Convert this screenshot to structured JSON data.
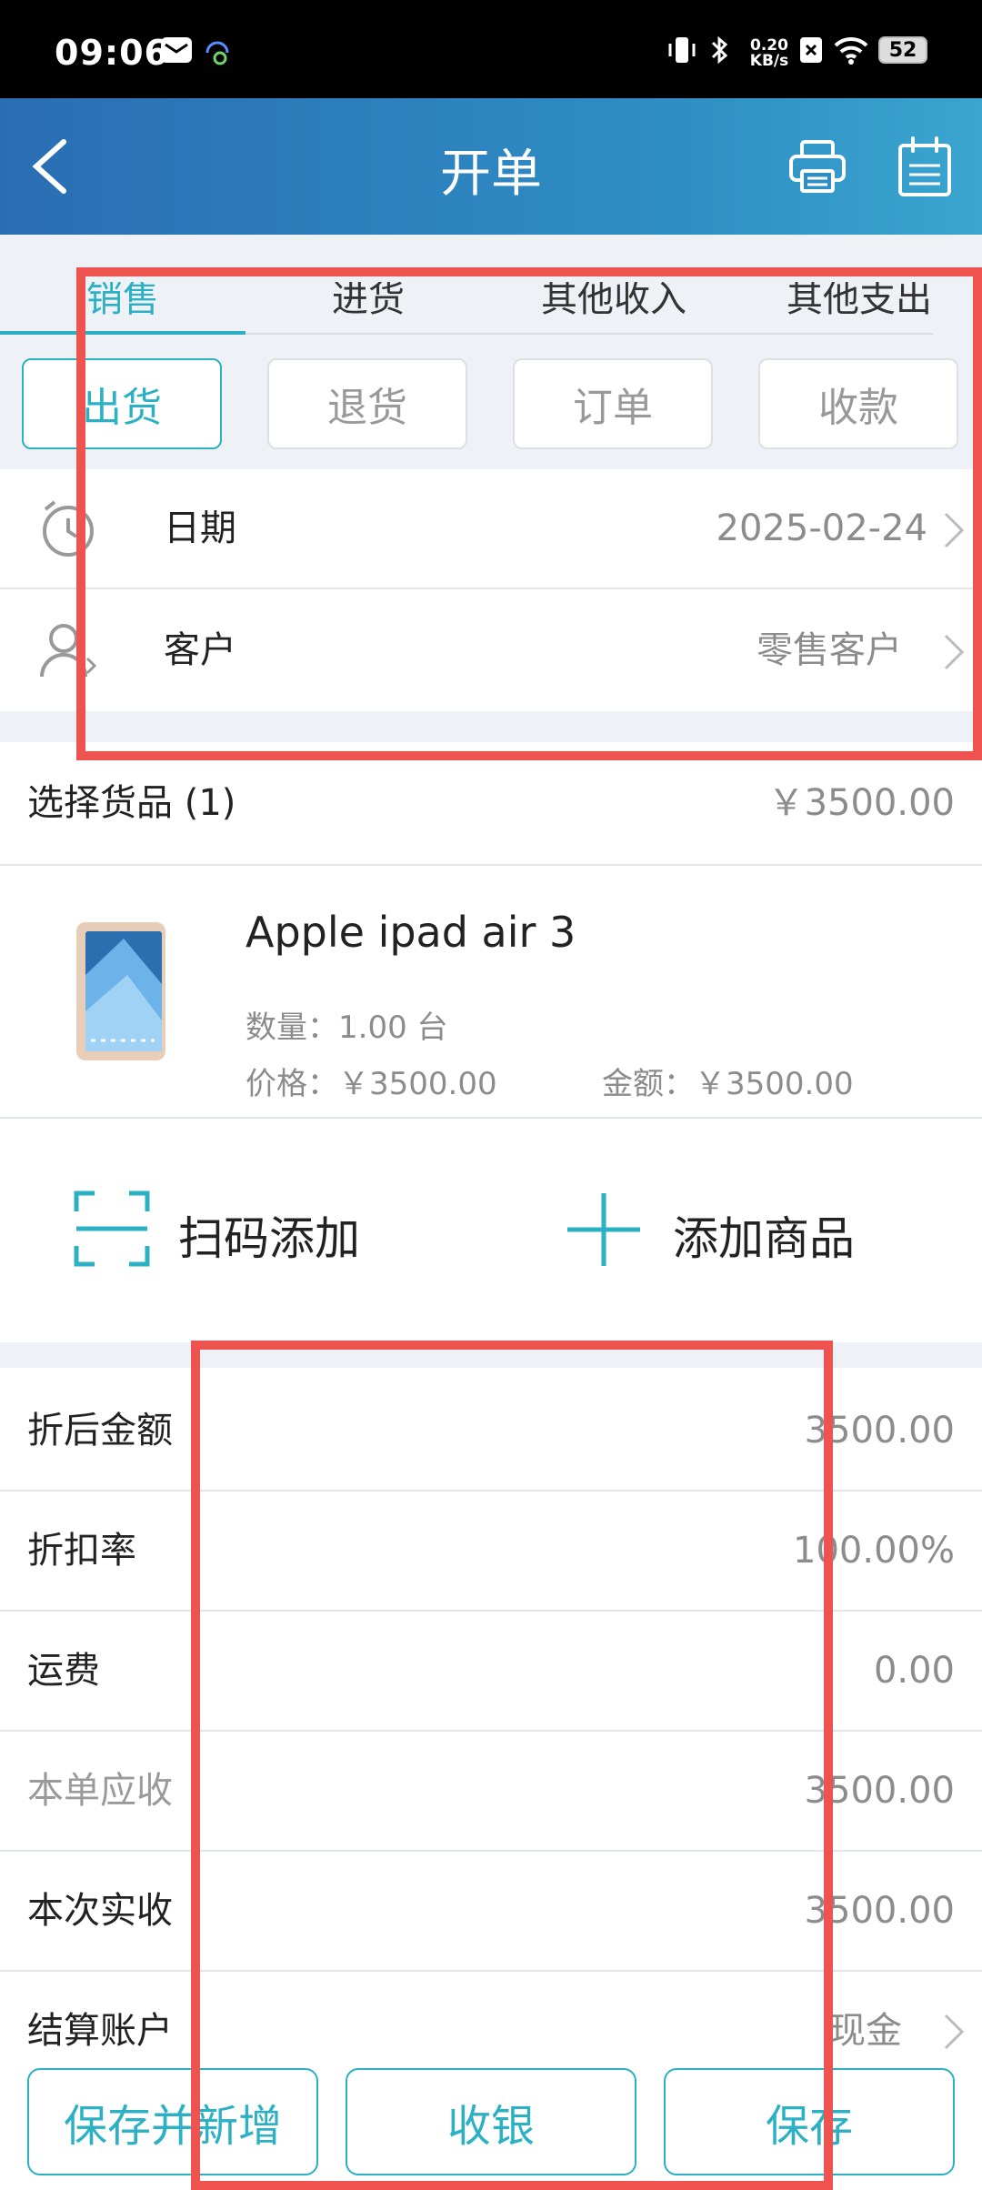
{
  "status_bar": {
    "time": "09:06",
    "speed_value": "0.20",
    "speed_unit": "KB/s",
    "battery": "52"
  },
  "app_bar": {
    "title": "开单"
  },
  "tabs": [
    {
      "label": "销售",
      "active": true
    },
    {
      "label": "进货",
      "active": false
    },
    {
      "label": "其他收入",
      "active": false
    },
    {
      "label": "其他支出",
      "active": false
    }
  ],
  "sub_tabs": [
    {
      "label": "出货",
      "active": true
    },
    {
      "label": "退货",
      "active": false
    },
    {
      "label": "订单",
      "active": false
    },
    {
      "label": "收款",
      "active": false
    }
  ],
  "info": {
    "date_label": "日期",
    "date_value": "2025-02-24",
    "customer_label": "客户",
    "customer_value": "零售客户"
  },
  "goods": {
    "header_label": "选择货品 (1)",
    "header_total": "￥3500.00",
    "product_name": "Apple ipad air 3",
    "quantity": "数量：1.00 台",
    "price": "价格：￥3500.00",
    "amount": "金额：￥3500.00"
  },
  "actions": {
    "scan_add": "扫码添加",
    "add_product": "添加商品"
  },
  "summary": [
    {
      "label": "折后金额",
      "value": "3500.00",
      "muted": false
    },
    {
      "label": "折扣率",
      "value": "100.00%",
      "muted": false
    },
    {
      "label": "运费",
      "value": "0.00",
      "muted": false
    },
    {
      "label": "本单应收",
      "value": "3500.00",
      "muted": true
    },
    {
      "label": "本次实收",
      "value": "3500.00",
      "muted": false
    },
    {
      "label": "结算账户",
      "value": "现金",
      "muted": false
    }
  ],
  "bottom_buttons": {
    "save_new": "保存并新增",
    "checkout": "收银",
    "save": "保存"
  },
  "colors": {
    "accent": "#2bb0c4",
    "app_bar": "#2f8fc4",
    "highlight": "#ef5350"
  }
}
